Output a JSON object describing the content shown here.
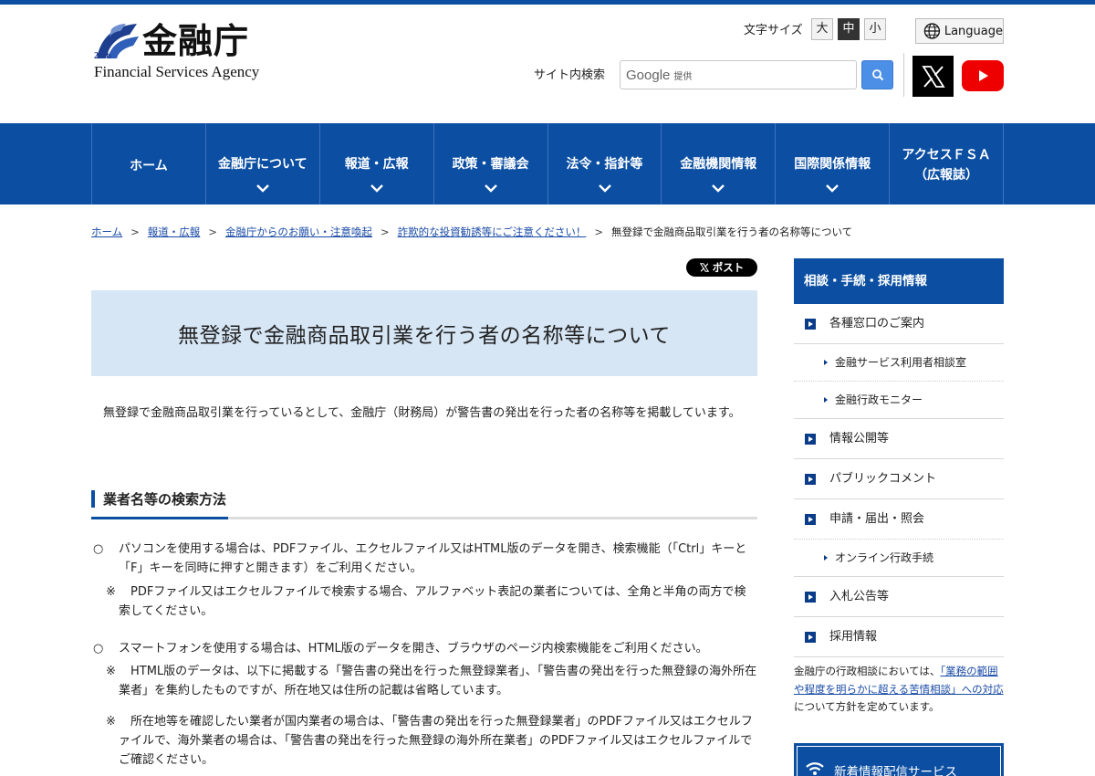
{
  "header": {
    "logo_kanji": "金融庁",
    "logo_english": "Financial Services Agency",
    "logo_anniv": "25th",
    "font_size_label": "文字サイズ",
    "font_sizes": [
      "大",
      "中",
      "小"
    ],
    "language_label": "Language",
    "search_label": "サイト内検索",
    "search_google": "Google",
    "search_provided": "提供"
  },
  "nav": {
    "items": [
      {
        "label": "ホーム"
      },
      {
        "label": "金融庁について"
      },
      {
        "label": "報道・広報"
      },
      {
        "label": "政策・審議会"
      },
      {
        "label": "法令・指針等"
      },
      {
        "label": "金融機関情報"
      },
      {
        "label": "国際関係情報"
      },
      {
        "label_line1": "アクセスＦＳＡ",
        "label_line2": "（広報誌）"
      }
    ]
  },
  "breadcrumb": {
    "items": [
      "ホーム",
      "報道・広報",
      "金融庁からのお願い・注意喚起",
      "詐欺的な投資勧誘等にご注意ください！"
    ],
    "current": "無登録で金融商品取引業を行う者の名称等について",
    "separator": ">"
  },
  "main": {
    "post_label": "ポスト",
    "title": "無登録で金融商品取引業を行う者の名称等について",
    "intro": "無登録で金融商品取引業を行っているとして、金融庁（財務局）が警告書の発出を行った者の名称等を掲載しています。",
    "section_title": "業者名等の検索方法",
    "bullets": [
      {
        "mark": "○",
        "text": "パソコンを使用する場合は、PDFファイル、エクセルファイル又はHTML版のデータを開き、検索機能（「Ctrl」キーと「F」キーを同時に押すと開きます）をご利用ください。",
        "notes": [
          {
            "mark": "※",
            "text": "PDFファイル又はエクセルファイルで検索する場合、アルファベット表記の業者については、全角と半角の両方で検索してください。"
          }
        ]
      },
      {
        "mark": "○",
        "text": "スマートフォンを使用する場合は、HTML版のデータを開き、ブラウザのページ内検索機能をご利用ください。",
        "notes": [
          {
            "mark": "※",
            "text": "HTML版のデータは、以下に掲載する「警告書の発出を行った無登録業者」、「警告書の発出を行った無登録の海外所在業者」を集約したものですが、所在地又は住所の記載は省略しています。"
          },
          {
            "mark": "※",
            "text": "所在地等を確認したい業者が国内業者の場合は、「警告書の発出を行った無登録業者」のPDFファイル又はエクセルファイルで、海外業者の場合は、「警告書の発出を行った無登録の海外所在業者」のPDFファイル又はエクセルファイルでご確認ください。"
          }
        ]
      }
    ]
  },
  "sidebar": {
    "heading": "相談・手続・採用情報",
    "items": [
      {
        "label": "各種窓口のご案内"
      },
      {
        "label": "金融サービス利用者相談室"
      },
      {
        "label": "金融行政モニター"
      },
      {
        "label": "情報公開等"
      },
      {
        "label": "パブリックコメント"
      },
      {
        "label": "申請・届出・照会"
      },
      {
        "label": "オンライン行政手続"
      },
      {
        "label": "入札公告等"
      },
      {
        "label": "採用情報"
      }
    ],
    "note_prefix": "金融庁の行政相談においては、",
    "note_link": "「業務の範囲や程度を明らかに超える苦情相談」への対応",
    "note_suffix": "について方針を定めています。",
    "news_label": "新着情報配信サービス"
  },
  "colors": {
    "brand_blue": "#0b4ea2",
    "title_bg": "#d7e6f5",
    "link": "#1a4ba6"
  }
}
